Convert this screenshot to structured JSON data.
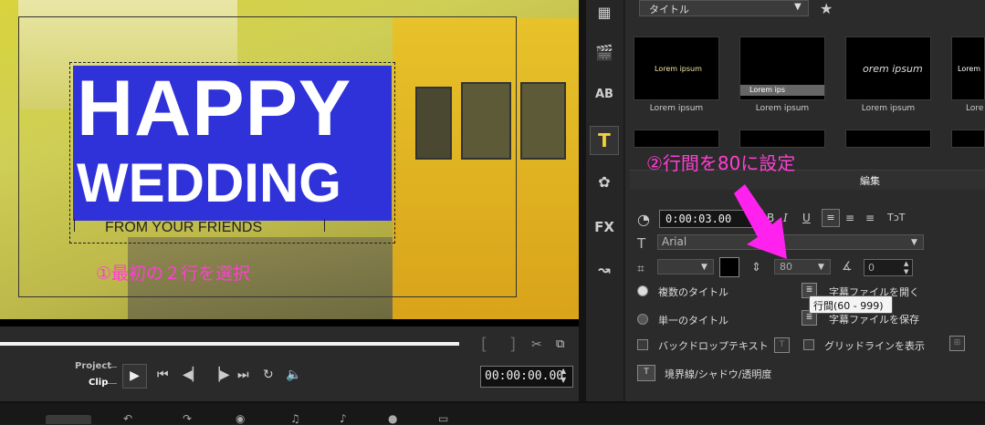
{
  "preview": {
    "title_line1": "HAPPY",
    "title_line2": "WEDDING",
    "title_line3": "FROM YOUR FRIENDS",
    "annotation1": "①最初の２行を選択"
  },
  "playback": {
    "project_label": "Project",
    "clip_label": "Clip",
    "timecode": "00:00:00.00",
    "icons": [
      "play-icon",
      "home-icon",
      "prev-frame-icon",
      "next-frame-icon",
      "end-icon",
      "repeat-icon",
      "volume-icon"
    ]
  },
  "library": {
    "category": "タイトル",
    "thumbs": [
      {
        "preview_text": "Lorem ipsum",
        "caption": "Lorem ipsum"
      },
      {
        "preview_text": "Lorem ips",
        "caption": "Lorem ipsum"
      },
      {
        "preview_text": "orem ipsum",
        "caption": "Lorem ipsum"
      },
      {
        "preview_text": "Lorem",
        "caption": "Lore"
      }
    ]
  },
  "annotation2": "②行間を80に設定",
  "edit": {
    "tab_label": "編集",
    "duration": "0:00:03.00",
    "font": "Arial",
    "line_height": "80",
    "angle": "0",
    "italic": "I",
    "underline": "U",
    "multi_title": "複数のタイトル",
    "single_title": "単一のタイトル",
    "open_subtitle": "字幕ファイルを開く",
    "save_subtitle": "字幕ファイルを保存",
    "backdrop": "バックドロップテキスト",
    "gridlines": "グリッドラインを表示",
    "border_shadow": "境界線/シャドウ/透明度",
    "tooltip": "行間(60 - 999)"
  },
  "colors": {
    "annotation": "#ff3fd4",
    "title_bg": "#2e32d8",
    "arrow": "#ff22ee"
  }
}
